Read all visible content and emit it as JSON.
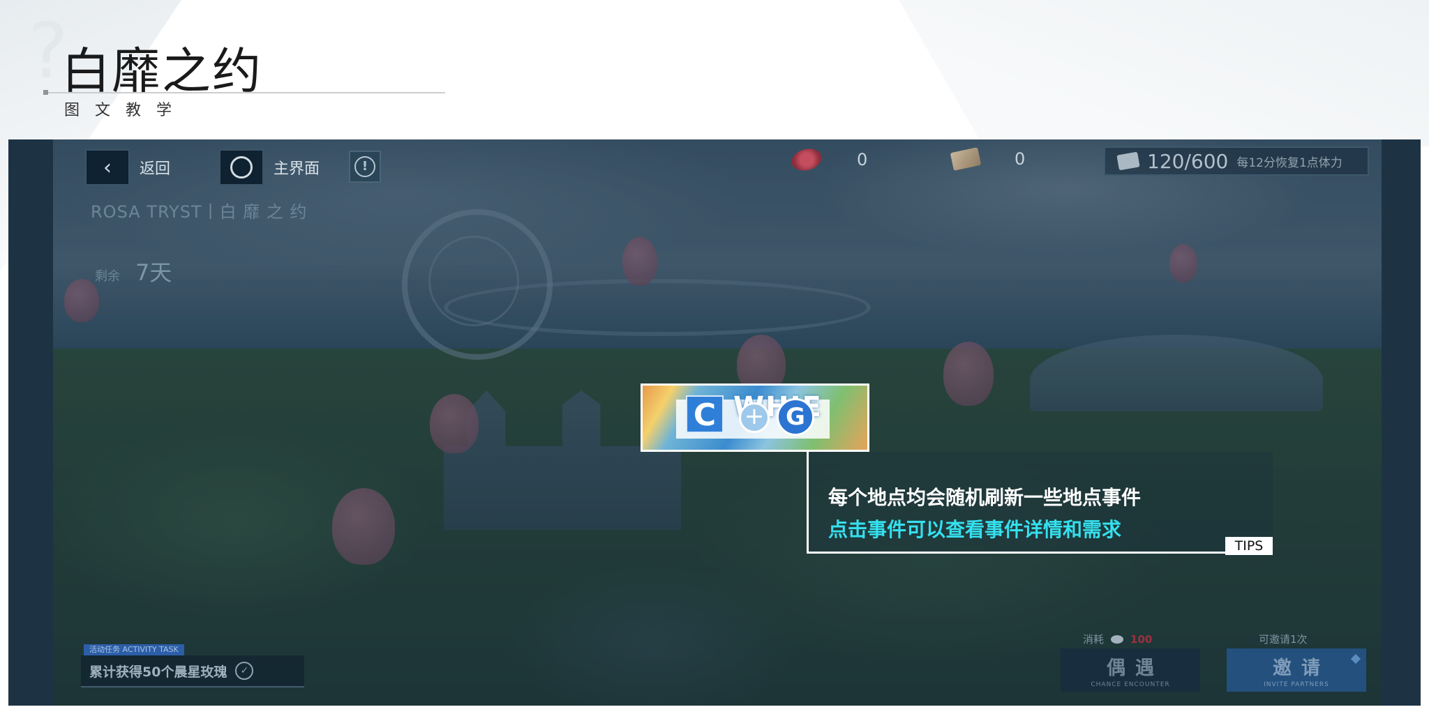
{
  "page": {
    "title": "白靡之约",
    "subtitle": "图文教学"
  },
  "hud": {
    "back_label": "返回",
    "home_label": "主界面",
    "currency_1": "0",
    "currency_2": "0",
    "stamina_value": "120/600",
    "stamina_note": "每12分恢复1点体力"
  },
  "event": {
    "subtitle": "ROSA TRYST丨白 靡 之 约",
    "remaining_label": "剩余",
    "remaining_value": "7天"
  },
  "activity_task": {
    "tag": "活动任务 ACTIVITY TASK",
    "text": "累计获得50个晨星玫瑰"
  },
  "actions": {
    "consume_label": "消耗",
    "consume_amount": "100",
    "invite_note": "可邀请1次",
    "encounter_label": "偶遇",
    "encounter_sub": "CHANCE ENCOUNTER",
    "invite_label": "邀请",
    "invite_sub": "INVITE PARTNERS"
  },
  "highlight": {
    "icon_c": "C",
    "icon_plus": "+",
    "icon_g": "G",
    "partial_text": "WHIE"
  },
  "tips": {
    "line1": "每个地点均会随机刷新一些地点事件",
    "line2": "点击事件可以查看事件详情和需求",
    "tag": "TIPS"
  },
  "colors": {
    "tips_highlight": "#35e0ee",
    "frame_bg": "#1d3344",
    "consume_amount": "#9b3040"
  },
  "icons": [
    "back-chevron-icon",
    "home-circle-icon",
    "info-icon",
    "rose-chip-icon",
    "ticket-icon",
    "stamina-icon",
    "check-circle-icon",
    "plus-icon"
  ]
}
